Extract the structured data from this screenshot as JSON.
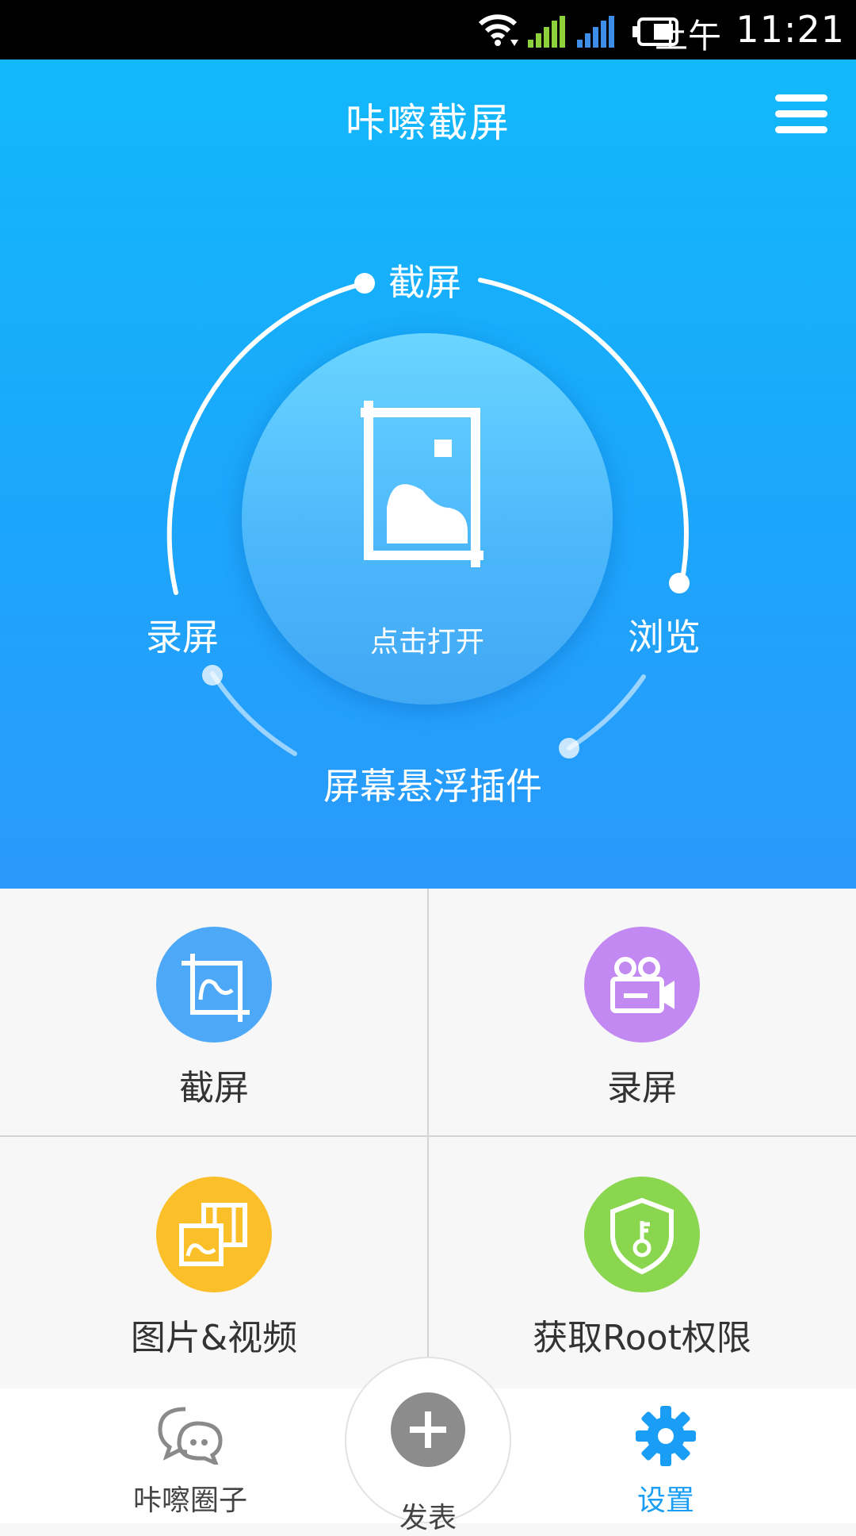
{
  "status_bar": {
    "ampm": "上午",
    "time": "11:21",
    "icons": [
      "wifi-icon",
      "signal-icon",
      "signal-icon",
      "battery-icon"
    ]
  },
  "header": {
    "title": "咔嚓截屏",
    "menu_icon": "menu-icon"
  },
  "hero": {
    "center_label": "点击打开",
    "center_icon": "crop-image-icon",
    "ring_labels": {
      "top": "截屏",
      "left": "录屏",
      "right": "浏览",
      "bottom": "屏幕悬浮插件"
    }
  },
  "features": [
    {
      "label": "截屏",
      "icon": "crop-icon",
      "color": "#4da9f7"
    },
    {
      "label": "录屏",
      "icon": "video-camera-icon",
      "color": "#c289f2"
    },
    {
      "label": "图片&视频",
      "icon": "gallery-icon",
      "color": "#fbbf2a"
    },
    {
      "label": "获取Root权限",
      "icon": "shield-key-icon",
      "color": "#8ad64f"
    }
  ],
  "tab_bar": {
    "tabs": [
      {
        "label": "咔嚓圈子",
        "icon": "chat-bubbles-icon",
        "active": false
      },
      {
        "label": "发表",
        "icon": "plus-icon",
        "active": false
      },
      {
        "label": "设置",
        "icon": "gear-icon",
        "active": true
      }
    ],
    "active_color": "#1a9ef5",
    "inactive_color": "#444444"
  }
}
